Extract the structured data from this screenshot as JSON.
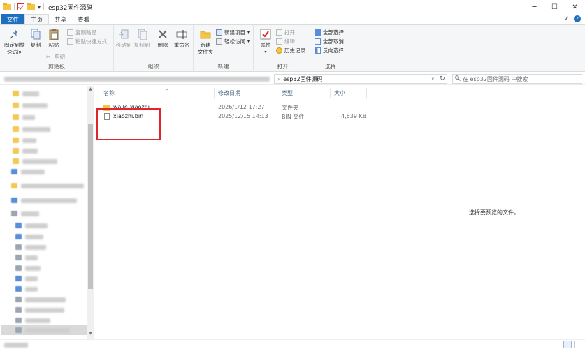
{
  "window": {
    "title": "esp32固件源码",
    "controls": {
      "minimize": "─",
      "maximize": "☐",
      "close": "✕"
    }
  },
  "quick_access": {
    "dropdown_arrow": "▾"
  },
  "tabs": [
    {
      "label": "文件"
    },
    {
      "label": "主页"
    },
    {
      "label": "共享"
    },
    {
      "label": "查看"
    }
  ],
  "tabs_right": {
    "expand": "∨",
    "help": "?"
  },
  "ribbon": {
    "clipboard": {
      "label": "剪贴板",
      "pin": "固定到快\n速访问",
      "copy": "复制",
      "paste": "粘贴",
      "copy_path": "复制路径",
      "paste_shortcut": "粘贴快捷方式",
      "cut": "剪切"
    },
    "organize": {
      "label": "组织",
      "move_to": "移动到",
      "copy_to": "复制到",
      "delete": "删除",
      "rename": "重命名"
    },
    "new": {
      "label": "新建",
      "new_folder": "新建\n文件夹",
      "new_item": "新建项目",
      "easy_access": "轻松访问"
    },
    "open": {
      "label": "打开",
      "properties": "属性",
      "open": "打开",
      "edit": "编辑",
      "history": "历史记录"
    },
    "select": {
      "label": "选择",
      "select_all": "全部选择",
      "select_none": "全部取消",
      "invert": "反向选择"
    }
  },
  "address": {
    "path": "esp32固件源码",
    "chevron": "›",
    "dropdown": "∨",
    "refresh": "↻",
    "search_placeholder": "在 esp32固件源码 中搜索",
    "search_icon": "search-icon"
  },
  "nav": {
    "scroll_up": "▲",
    "scroll_down": "▼"
  },
  "columns": {
    "name": "名称",
    "modified": "修改日期",
    "type": "类型",
    "size": "大小",
    "sort_indicator": "^"
  },
  "files": [
    {
      "name": "walle-xiaozhi",
      "modified": "2026/1/12 17:27",
      "type": "文件夹",
      "size": "",
      "kind": "folder"
    },
    {
      "name": "xiaozhi.bin",
      "modified": "2025/12/15 14:13",
      "type": "BIN 文件",
      "size": "4,639 KB",
      "kind": "file"
    }
  ],
  "preview": {
    "empty_text": "选择要预览的文件。"
  },
  "colors": {
    "accent": "#1f6fbf",
    "highlight_box": "#e0262c",
    "folder": "#f4c542"
  }
}
